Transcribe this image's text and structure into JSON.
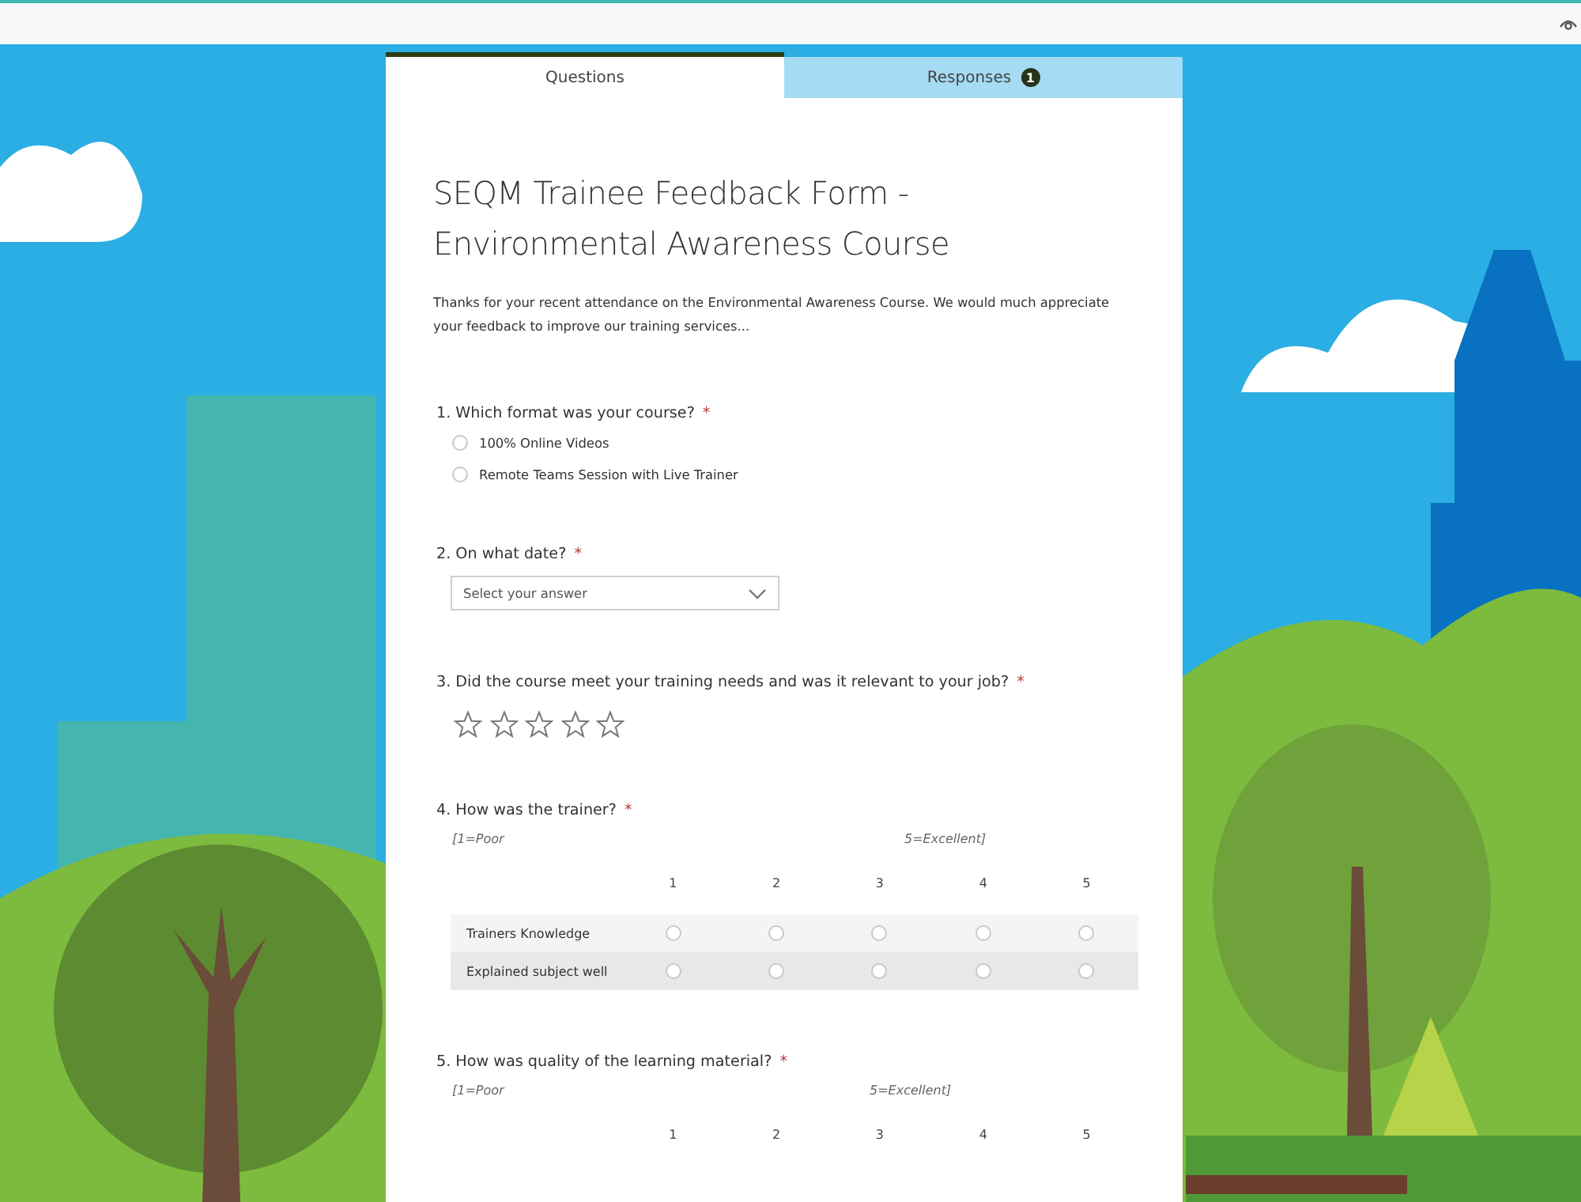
{
  "tabs": [
    {
      "label": "Questions",
      "selected": true
    },
    {
      "label": "Responses",
      "selected": false,
      "badge": "1"
    }
  ],
  "form": {
    "title": "SEQM Trainee Feedback Form - Environmental Awareness Course",
    "description": "Thanks for your recent attendance on the Environmental Awareness Course. We would much appreciate your feedback to improve our training services..."
  },
  "questions": [
    {
      "kind": "choice",
      "number": "1.",
      "text": "Which format was your course?",
      "required_mark": "*",
      "options": [
        {
          "label": "100% Online Videos",
          "selected": false
        },
        {
          "label": "Remote Teams Session with Live Trainer",
          "selected": false
        }
      ]
    },
    {
      "kind": "dropdown",
      "number": "2.",
      "text": "On what date?",
      "required_mark": "*",
      "placeholder": "Select your answer"
    },
    {
      "kind": "rating",
      "number": "3.",
      "text": "Did the course meet your training needs and was it relevant to your job?",
      "required_mark": "*",
      "stars": 0
    },
    {
      "kind": "likert",
      "number": "4.",
      "text": "How was the trainer?",
      "required_mark": "*",
      "scale_low": "[1=Poor",
      "scale_high": "5=Excellent]",
      "columns": [
        "1",
        "2",
        "3",
        "4",
        "5"
      ],
      "rows": [
        {
          "label": "Trainers Knowledge",
          "cells": [
            {
              "selected": false
            },
            {
              "selected": false
            },
            {
              "selected": false
            },
            {
              "selected": false
            },
            {
              "selected": false
            }
          ]
        },
        {
          "label": "Explained subject well",
          "cells": [
            {
              "selected": false
            },
            {
              "selected": false
            },
            {
              "selected": false
            },
            {
              "selected": false
            },
            {
              "selected": false
            }
          ]
        }
      ]
    },
    {
      "kind": "likert",
      "number": "5.",
      "text": "How was quality of the learning material?",
      "required_mark": "*",
      "scale_low": "[1=Poor",
      "scale_high": "5=Excellent]",
      "columns": [
        "1",
        "2",
        "3",
        "4",
        "5"
      ]
    }
  ]
}
